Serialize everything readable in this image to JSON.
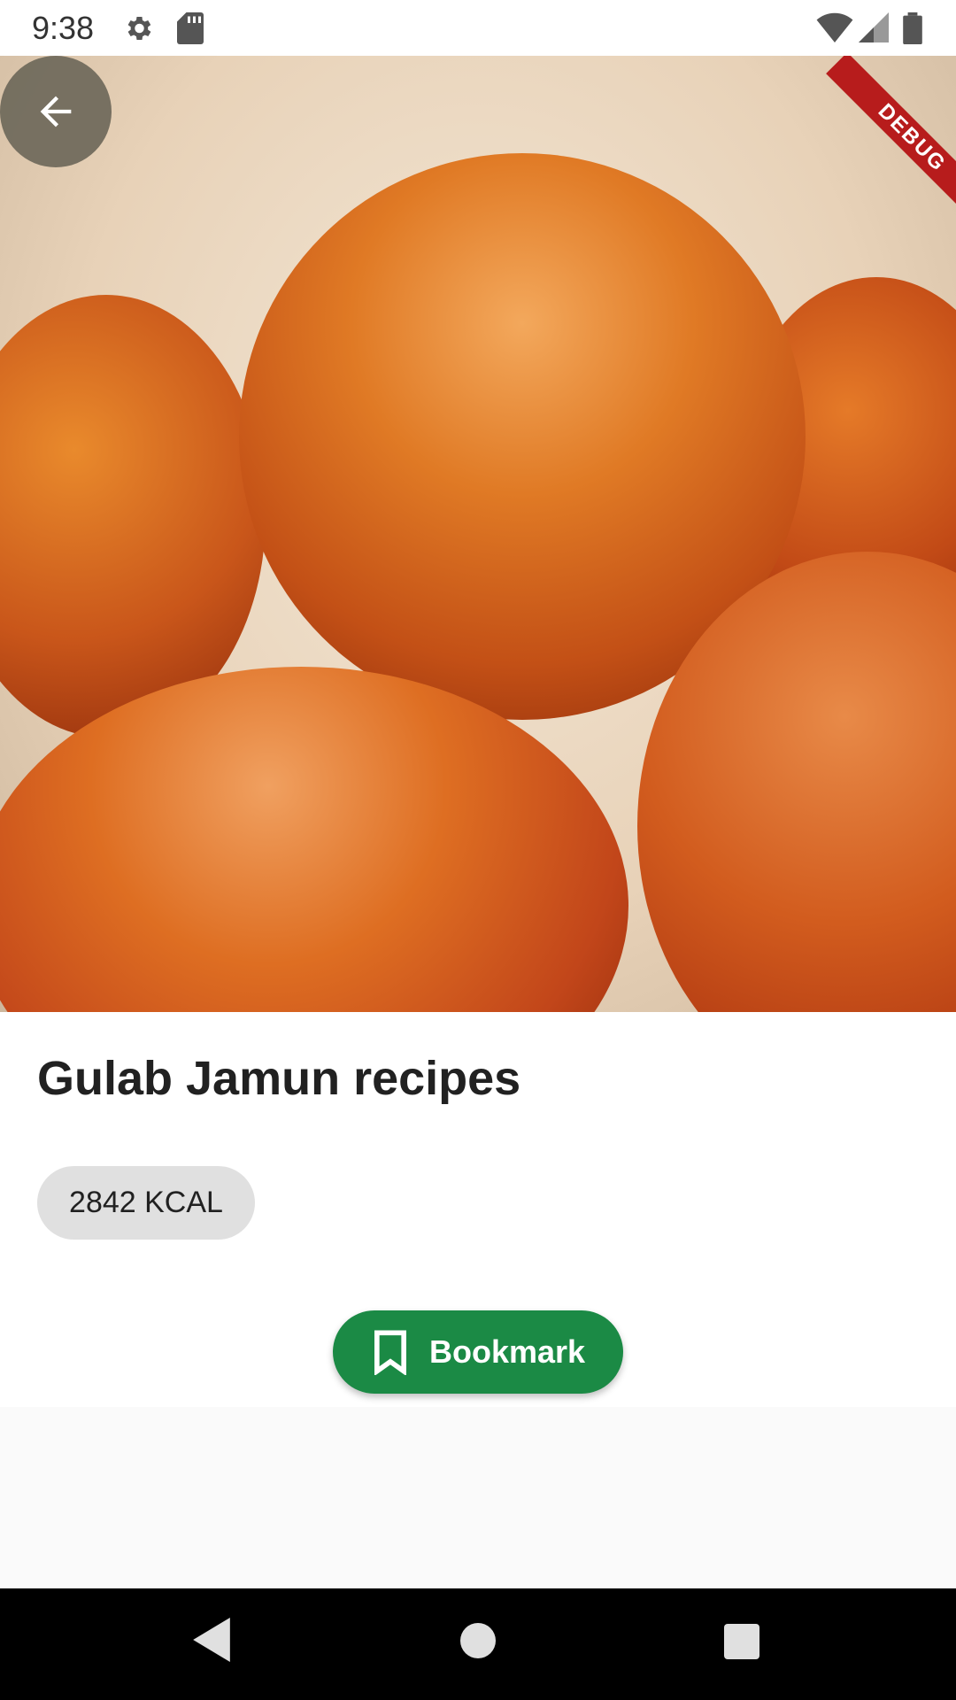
{
  "status_bar": {
    "time": "9:38",
    "icons": [
      "settings-icon",
      "sd-card-icon",
      "wifi-icon",
      "signal-icon",
      "battery-icon"
    ]
  },
  "hero": {
    "image_description": "gulab jamun",
    "debug_badge": "DEBUG"
  },
  "recipe": {
    "title": "Gulab Jamun recipes",
    "calories": "2842 KCAL"
  },
  "actions": {
    "bookmark_label": "Bookmark"
  },
  "colors": {
    "accent": "#1b8a45",
    "chip": "#e0e0e0"
  }
}
